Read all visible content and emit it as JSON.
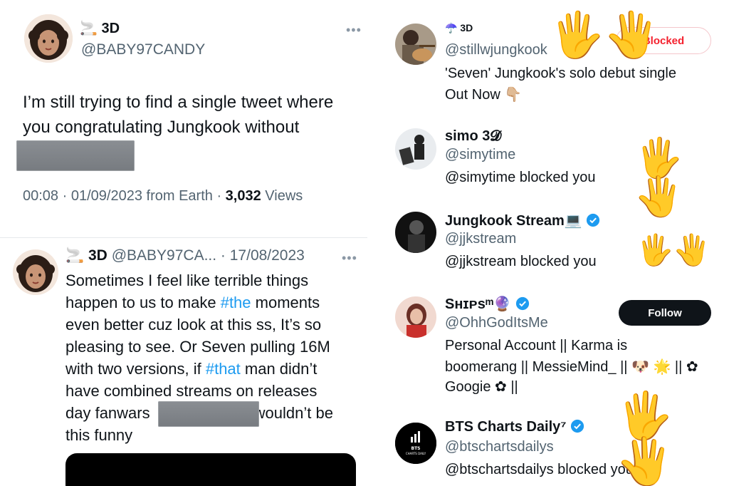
{
  "left": {
    "tweet1": {
      "emoji": "🚬",
      "display_name": "3D",
      "handle": "@BABY97CANDY",
      "text_line1": "I’m still trying to find a single tweet where",
      "text_line2": "you congratulating Jungkook without",
      "time": "00:08",
      "date": "01/09/2023",
      "source": "from Earth",
      "views_count": "3,032",
      "views_label": "Views"
    },
    "tweet2": {
      "emoji": "🚬",
      "display_name": "3D",
      "handle_date": "@BABY97CA... · 17/08/2023",
      "line1": "Sometimes I feel like terrible things",
      "line2_pre": "happen to us to make ",
      "line2_tag": "#the",
      "line2_post": " moments",
      "line3": "even better cuz look at this ss, It’s so",
      "line4": "pleasing to see. Or Seven pulling 16M",
      "line5_pre": "with two versions, if ",
      "line5_tag": "#that",
      "line5_post": " man didn’t",
      "line6": "have combined streams on releases",
      "line7_pre": "day fanwars",
      "line7_post": "wouldn’t be",
      "line8": "this funny"
    }
  },
  "right": {
    "user1": {
      "emoji": "☂️",
      "display_name": "3D",
      "handle": "@stillwjungkook",
      "bio_line1": "'Seven' Jungkook's solo debut single",
      "bio_line2": "Out Now 👇🏼",
      "button": "Blocked"
    },
    "user2": {
      "display_name": "simo 3𝓓",
      "handle": "@simytime",
      "status": "@simytime blocked you"
    },
    "user3": {
      "display_name": "Jungkook Stream💻",
      "handle": "@jjkstream",
      "status": "@jjkstream blocked you"
    },
    "user4": {
      "display_name": "Sʜɪᴘsᵐ🔮",
      "handle": "@OhhGodItsMe",
      "bio_line1": "Personal Account || Karma is",
      "bio_line2": "boomerang || MessieMind_ || 🐶 🌟 || ✿",
      "bio_line3": "Googie ✿ ||",
      "button": "Follow"
    },
    "user5": {
      "display_name": "BTS Charts Daily⁷",
      "handle": "@btschartsdailys",
      "status": "@btschartsdailys blocked you",
      "avatar_text_line1": "BTS",
      "avatar_text_line2": "CHARTS DAILY"
    }
  },
  "overlay": {
    "hand_glyph": "🖐"
  },
  "colors": {
    "text": "#0f1419",
    "muted": "#536471",
    "link": "#1d9bf0",
    "verified": "#1d9bf0",
    "blocked": "#f4212e",
    "hand": "#f6c640"
  }
}
